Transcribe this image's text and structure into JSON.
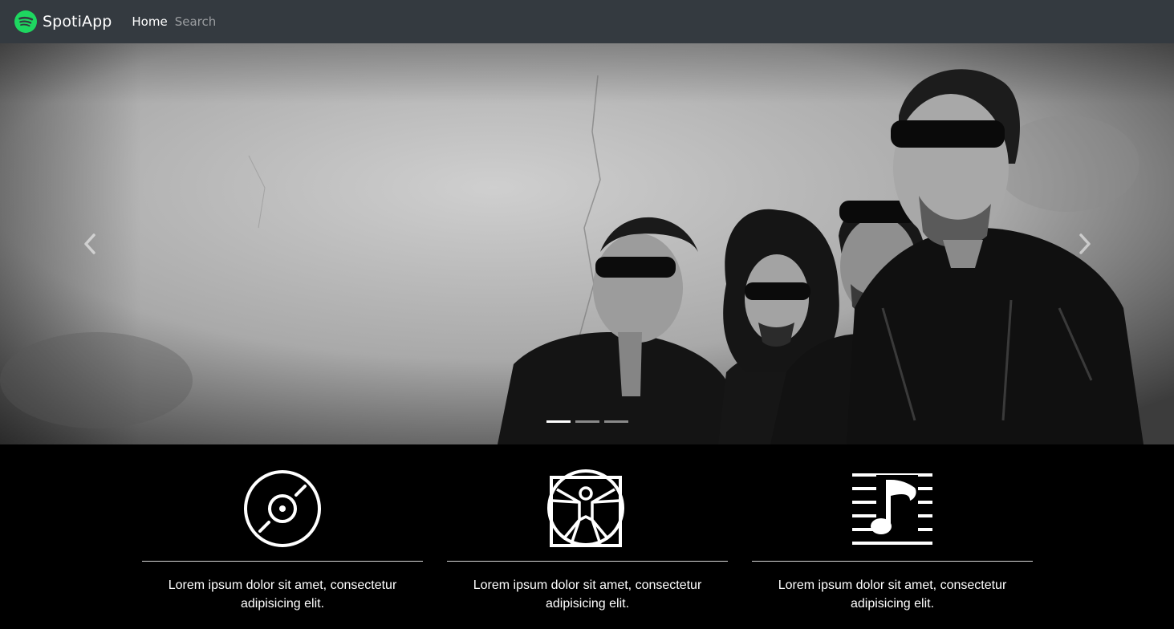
{
  "navbar": {
    "brand_name": "SpotiApp",
    "brand_icon": "spotify-logo-icon",
    "brand_color": "#1ed760",
    "background": "#343a40",
    "links": [
      {
        "label": "Home",
        "active": true
      },
      {
        "label": "Search",
        "active": false
      }
    ]
  },
  "carousel": {
    "slide_count": 3,
    "active_slide": 1,
    "prev_icon": "chevron-left-icon",
    "next_icon": "chevron-right-icon"
  },
  "features": [
    {
      "icon": "vinyl-record-icon",
      "text": "Lorem ipsum dolor sit amet, consectetur adipisicing elit."
    },
    {
      "icon": "vitruvian-man-icon",
      "text": "Lorem ipsum dolor sit amet, consectetur adipisicing elit."
    },
    {
      "icon": "music-sheet-icon",
      "text": "Lorem ipsum dolor sit amet, consectetur adipisicing elit."
    }
  ]
}
